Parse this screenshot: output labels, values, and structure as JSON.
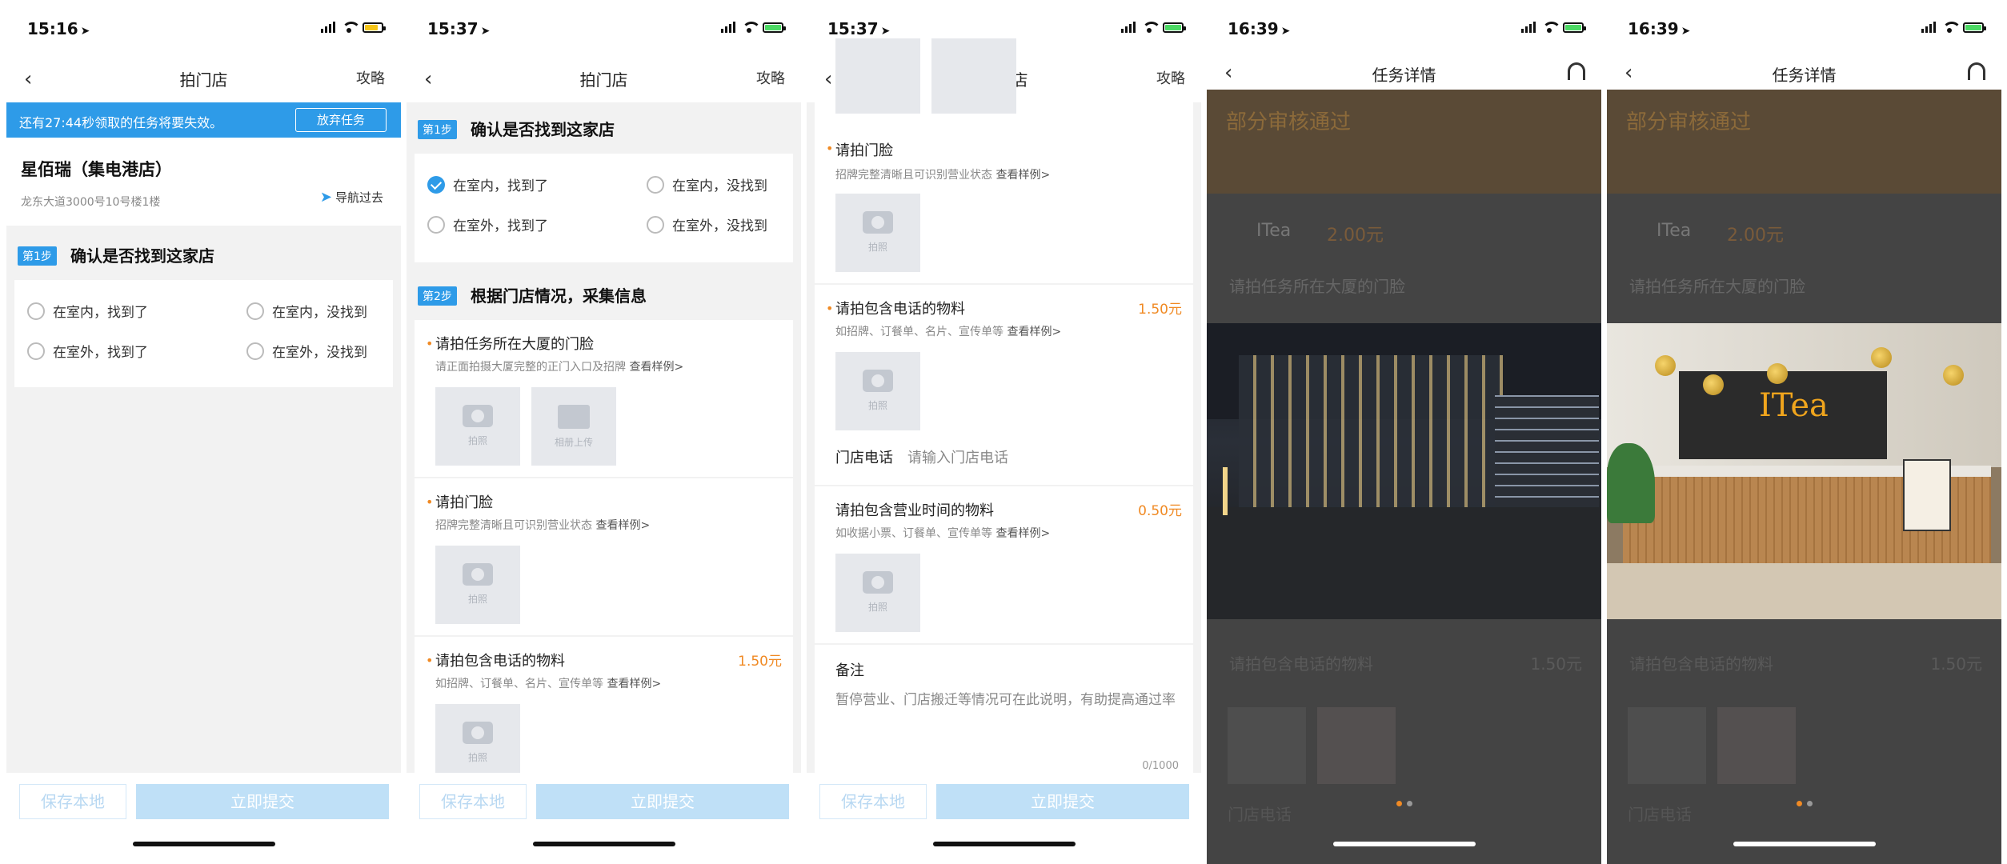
{
  "screens": [
    {
      "time": "15:16",
      "title": "拍门店",
      "right": "攻略"
    },
    {
      "time": "15:37",
      "title": "拍门店",
      "right": "攻略"
    },
    {
      "time": "15:37",
      "title": "拍门店",
      "right": "攻略"
    },
    {
      "time": "16:39",
      "title": "任务详情"
    },
    {
      "time": "16:39",
      "title": "任务详情"
    }
  ],
  "banner": {
    "text": "还有27:44秒领取的任务将要失效。",
    "giveup": "放弃任务"
  },
  "store": {
    "name": "星佰瑞（集电港店）",
    "address": "龙东大道3000号10号楼1楼",
    "navigate": "导航过去"
  },
  "step1": {
    "tag": "第1步",
    "title": "确认是否找到这家店"
  },
  "step2": {
    "tag": "第2步",
    "title": "根据门店情况，采集信息"
  },
  "options": [
    "在室内，找到了",
    "在室内，没找到",
    "在室外，找到了",
    "在室外，没找到"
  ],
  "tasks": {
    "building": {
      "title": "请拍任务所在大厦的门脸",
      "desc": "请正面拍摄大厦完整的正门入口及招牌",
      "example": "查看样例>"
    },
    "storefront": {
      "title": "请拍门脸",
      "desc": "招牌完整清晰且可识别营业状态",
      "example": "查看样例>"
    },
    "phone_material": {
      "title": "请拍包含电话的物料",
      "price": "1.50元",
      "desc": "如招牌、订餐单、名片、宣传单等",
      "example": "查看样例>"
    },
    "hours_material": {
      "title": "请拍包含营业时间的物料",
      "price": "0.50元",
      "desc": "如收据小票、订餐单、宣传单等",
      "example": "查看样例>"
    }
  },
  "photo": {
    "shoot": "拍照",
    "upload": "相册上传"
  },
  "phone": {
    "label": "门店电话",
    "placeholder": "请输入门店电话"
  },
  "remark": {
    "title": "备注",
    "text": "暂停营业、门店搬迁等情况可在此说明，有助提高通过率",
    "count": "0/1000"
  },
  "footer": {
    "save": "保存本地",
    "submit": "立即提交"
  },
  "detail": {
    "status": "部分审核通过",
    "store": "ITea",
    "price": "2.00元",
    "section_title": "请拍任务所在大厦的门脸",
    "phone_section": "请拍包含电话的物料",
    "phone_price": "1.50元",
    "phone_label": "门店电话"
  }
}
